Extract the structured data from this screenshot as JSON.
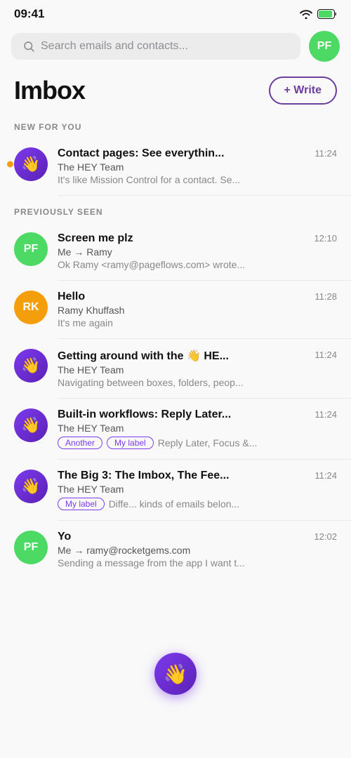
{
  "statusBar": {
    "time": "09:41"
  },
  "search": {
    "placeholder": "Search emails and contacts..."
  },
  "userAvatar": {
    "initials": "PF",
    "label": "User Avatar PF"
  },
  "header": {
    "title": "Imbox",
    "writeButton": "+ Write"
  },
  "sections": [
    {
      "label": "NEW FOR YOU",
      "emails": [
        {
          "id": "hey-contact-pages",
          "avatarType": "hey",
          "unread": true,
          "subject": "Contact pages: See everythin...",
          "time": "11:24",
          "sender": "The HEY Team",
          "preview": "It's like Mission Control for a contact. Se...",
          "tags": []
        }
      ]
    },
    {
      "label": "PREVIOUSLY SEEN",
      "emails": [
        {
          "id": "screen-me-plz",
          "avatarType": "pf",
          "unread": false,
          "subject": "Screen me plz",
          "time": "12:10",
          "sender": "Me → Ramy",
          "preview": "Ok Ramy <ramy@pageflows.com> wrote...",
          "tags": []
        },
        {
          "id": "hello",
          "avatarType": "rk",
          "unread": false,
          "subject": "Hello",
          "time": "11:28",
          "sender": "Ramy Khuffash",
          "preview": "It's me again",
          "tags": []
        },
        {
          "id": "getting-around",
          "avatarType": "hey",
          "unread": false,
          "subject": "Getting around with the 👋 HE...",
          "time": "11:24",
          "sender": "The HEY Team",
          "preview": "Navigating between boxes, folders, peop...",
          "tags": []
        },
        {
          "id": "built-in-workflows",
          "avatarType": "hey",
          "unread": false,
          "subject": "Built-in workflows: Reply Later...",
          "time": "11:24",
          "sender": "The HEY Team",
          "preview": "Reply Later, Focus &...",
          "tags": [
            "Another",
            "My label"
          ]
        },
        {
          "id": "big-3",
          "avatarType": "hey",
          "unread": false,
          "subject": "The Big 3: The Imbox, The Fee...",
          "time": "11:24",
          "sender": "The HEY Team",
          "preview": "Diffe... kinds of emails belon...",
          "tags": [
            "My label"
          ]
        },
        {
          "id": "yo",
          "avatarType": "pf",
          "unread": false,
          "subject": "Yo",
          "time": "12:02",
          "sender": "Me → ramy@rocketgems.com",
          "preview": "Sending a message from the app I want t...",
          "tags": []
        }
      ]
    }
  ],
  "fab": {
    "label": "HEY logo floating action button"
  }
}
